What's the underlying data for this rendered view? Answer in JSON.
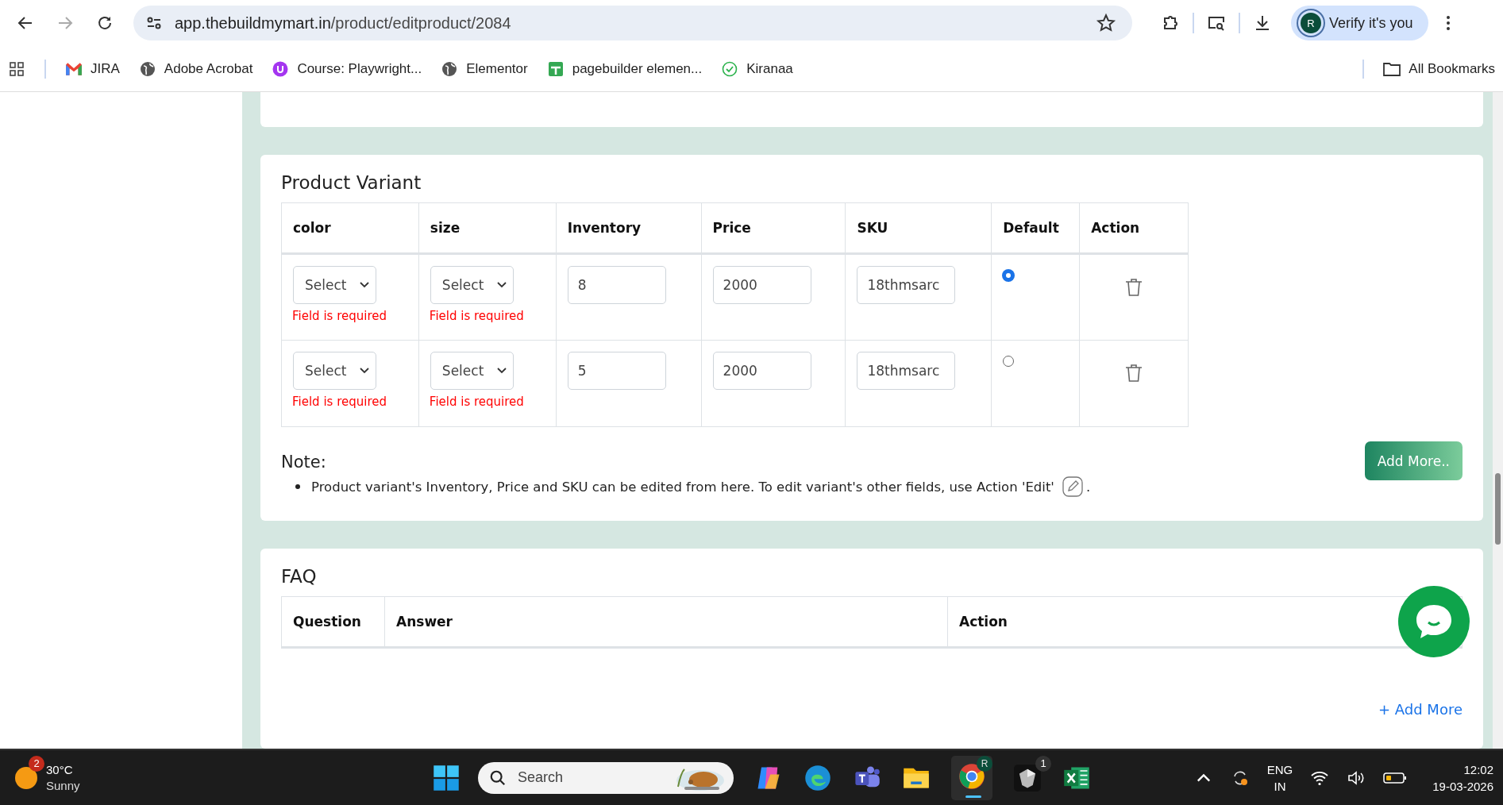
{
  "browser": {
    "url_host": "app.thebuildmymart.in",
    "url_path": "/product/editproduct/2084",
    "profile_avatar": "R",
    "profile_label": "Verify it's you",
    "bookmarks": [
      {
        "label": "JIRA",
        "kind": "gmail"
      },
      {
        "label": "Adobe Acrobat",
        "kind": "globe"
      },
      {
        "label": "Course: Playwright...",
        "kind": "course"
      },
      {
        "label": "Elementor",
        "kind": "globe"
      },
      {
        "label": "pagebuilder elemen...",
        "kind": "sheet"
      },
      {
        "label": "Kiranaa",
        "kind": "check"
      }
    ],
    "all_bookmarks": "All Bookmarks"
  },
  "variant_section": {
    "title": "Product Variant",
    "columns": [
      "color",
      "size",
      "Inventory",
      "Price",
      "SKU",
      "Default",
      "Action"
    ],
    "rows": [
      {
        "color": {
          "value": "Select",
          "error": "Field is required"
        },
        "size": {
          "value": "Select",
          "error": "Field is required"
        },
        "inventory": "8",
        "price": "2000",
        "sku": "18thmsarc",
        "selected": true
      },
      {
        "color": {
          "value": "Select",
          "error": "Field is required"
        },
        "size": {
          "value": "Select",
          "error": "Field is required"
        },
        "inventory": "5",
        "price": "2000",
        "sku": "18thmsarc",
        "selected": false
      }
    ],
    "note_title": "Note:",
    "note_items": [
      {
        "text": "Product variant's Inventory, Price and SKU can be edited from here. To edit variant's other fields, use Action 'Edit'",
        "trailing": "."
      }
    ],
    "add_button": "Add More.."
  },
  "faq_section": {
    "title": "FAQ",
    "columns": [
      "Question",
      "Answer",
      "Action"
    ],
    "add_link": "+ Add More"
  },
  "taskbar": {
    "weather": {
      "badge": "2",
      "temperature": "30°C",
      "condition": "Sunny"
    },
    "search_placeholder": "Search",
    "chrome_badge": "R",
    "app_badge": "1",
    "language": "ENG",
    "region": "IN",
    "time": "12:02",
    "date": "19-03-2026"
  }
}
